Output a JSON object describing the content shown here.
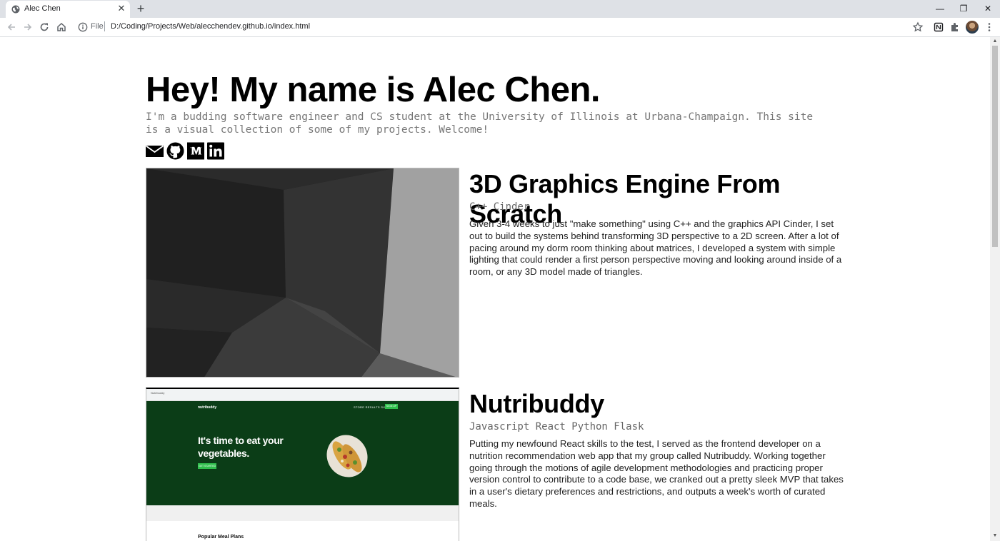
{
  "browser": {
    "tab_title": "Alec Chen",
    "tab_close": "✕",
    "new_tab": "+",
    "url_scheme": "File",
    "url": "D:/Coding/Projects/Web/alecchendev.github.io/index.html",
    "window_controls": {
      "minimize": "—",
      "restore": "❐",
      "close": "✕"
    }
  },
  "hero": {
    "title": "Hey! My name is Alec Chen.",
    "subtitle": "I'm a budding software engineer and CS student at the University of Illinois at Urbana-Champaign. This site is a visual collection of some of my projects. Welcome!",
    "socials": [
      "email-icon",
      "github-icon",
      "medium-icon",
      "linkedin-icon"
    ]
  },
  "projects": [
    {
      "title": "3D Graphics Engine From Scratch",
      "tags": "C++ Cinder",
      "description": "Given 3-4 weeks to just \"make something\" using C++ and the graphics API Cinder, I set out to build the systems behind transforming 3D perspective to a 2D screen. After a lot of pacing around my dorm room thinking about matrices, I developed a system with simple lighting that could render a first person perspective moving and looking around inside of a room, or any 3D model made of triangles."
    },
    {
      "title": "Nutribuddy",
      "tags": "Javascript React Python Flask",
      "description": "Putting my newfound React skills to the test, I served as the frontend developer on a nutrition recommendation web app that my group called Nutribuddy. Working together going through the motions of agile development methodologies and practicing proper version control to contribute to a code base, we cranked out a pretty sleek MVP that takes in a user's dietary preferences and restrictions, and outputs a week's worth of curated meals.",
      "screenshot": {
        "browser_tab": "Nutribuddy",
        "logo": "nutribuddy",
        "nav": "STORE   RESULTS   SIGN IN",
        "signup": "SIGN UP",
        "headline": "It's time to eat your vegetables.",
        "cta": "GET STARTED",
        "section": "Popular Meal Plans"
      }
    }
  ]
}
